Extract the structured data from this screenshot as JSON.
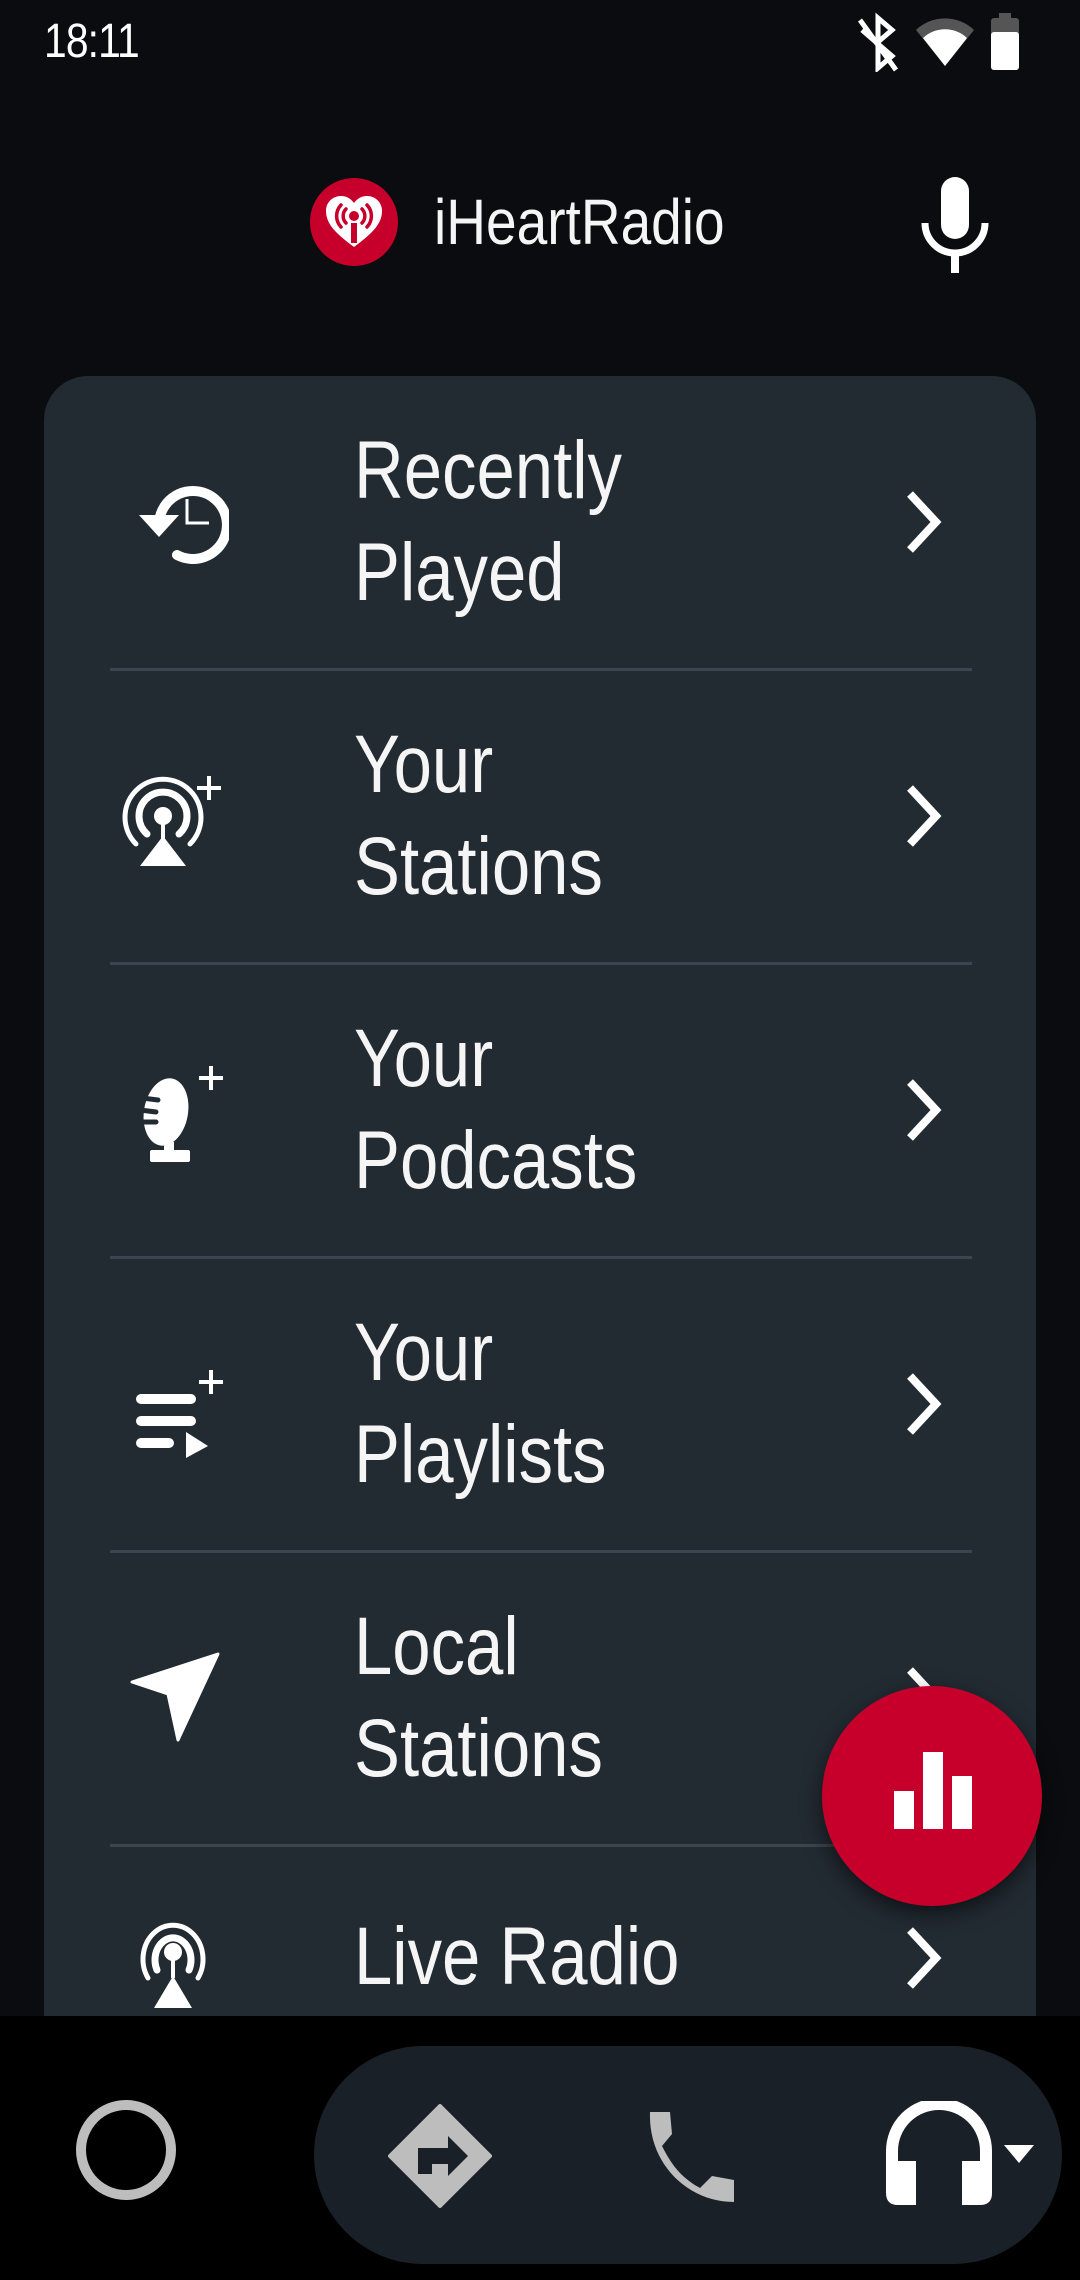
{
  "status_bar": {
    "time": "18:11",
    "icons": [
      "bluetooth-off-icon",
      "wifi-icon",
      "battery-icon"
    ]
  },
  "header": {
    "app_title": "iHeartRadio",
    "logo_icon": "iheartradio-logo",
    "voice_icon": "microphone-icon"
  },
  "menu": {
    "items": [
      {
        "label": "Recently Played",
        "line1": "Recently",
        "line2": "Played",
        "icon": "history-icon"
      },
      {
        "label": "Your Stations",
        "line1": "Your",
        "line2": "Stations",
        "icon": "radio-tower-add-icon"
      },
      {
        "label": "Your Podcasts",
        "line1": "Your",
        "line2": "Podcasts",
        "icon": "podcast-mic-add-icon"
      },
      {
        "label": "Your Playlists",
        "line1": "Your",
        "line2": "Playlists",
        "icon": "playlist-add-icon"
      },
      {
        "label": "Local Stations",
        "line1": "Local",
        "line2": "Stations",
        "icon": "location-arrow-icon"
      },
      {
        "label": "Live Radio",
        "line1": "Live Radio",
        "line2": "",
        "icon": "radio-tower-icon"
      }
    ]
  },
  "fab": {
    "icon": "now-playing-bars-icon"
  },
  "bottom_nav": {
    "home_icon": "home-circle-icon",
    "items": [
      {
        "name": "navigation",
        "icon": "directions-icon"
      },
      {
        "name": "phone",
        "icon": "phone-icon"
      },
      {
        "name": "media",
        "icon": "headphones-icon"
      }
    ]
  },
  "colors": {
    "brand_red": "#c6002b",
    "background": "#0a0c0f",
    "card": "#222a32",
    "divider": "#3b4450",
    "nav_pill": "#1a2027",
    "icon_gray": "#bdbdbd"
  }
}
